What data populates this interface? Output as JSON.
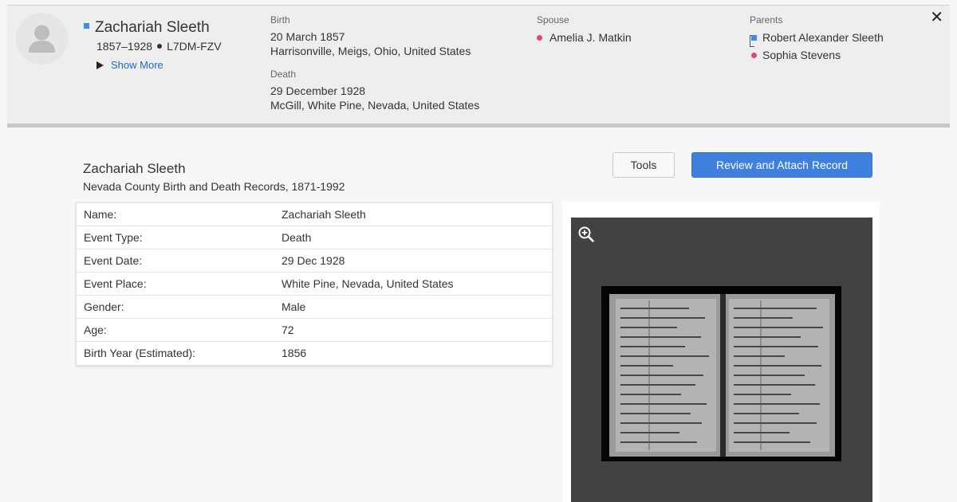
{
  "person": {
    "name": "Zachariah Sleeth",
    "lifespan": "1857–1928",
    "pid": "L7DM-FZV",
    "show_more": "Show More",
    "birth": {
      "label": "Birth",
      "date": "20 March 1857",
      "place": "Harrisonville, Meigs, Ohio, United States"
    },
    "death": {
      "label": "Death",
      "date": "29 December 1928",
      "place": "McGill, White Pine, Nevada, United States"
    },
    "spouse": {
      "label": "Spouse",
      "name": "Amelia J. Matkin"
    },
    "parents": {
      "label": "Parents",
      "father": "Robert Alexander Sleeth",
      "mother": "Sophia Stevens"
    },
    "close_symbol": "✕"
  },
  "record": {
    "title": "Zachariah Sleeth",
    "collection": "Nevada County Birth and Death Records, 1871-1992",
    "tools_label": "Tools",
    "attach_label": "Review and Attach Record",
    "facts": [
      {
        "label": "Name:",
        "value": "Zachariah Sleeth"
      },
      {
        "label": "Event Type:",
        "value": "Death"
      },
      {
        "label": "Event Date:",
        "value": "29 Dec 1928"
      },
      {
        "label": "Event Place:",
        "value": "White Pine, Nevada, United States"
      },
      {
        "label": "Gender:",
        "value": "Male"
      },
      {
        "label": "Age:",
        "value": "72"
      },
      {
        "label": "Birth Year (Estimated):",
        "value": "1856"
      }
    ]
  },
  "colors": {
    "male": "#3f8de0",
    "female": "#e0467a",
    "primary_button": "#3f80de",
    "viewer_bg": "#424242"
  },
  "icons": {
    "avatar": "person-silhouette-icon",
    "zoom": "zoom-in-icon",
    "close": "close-icon",
    "show_more": "triangle-right-icon"
  }
}
